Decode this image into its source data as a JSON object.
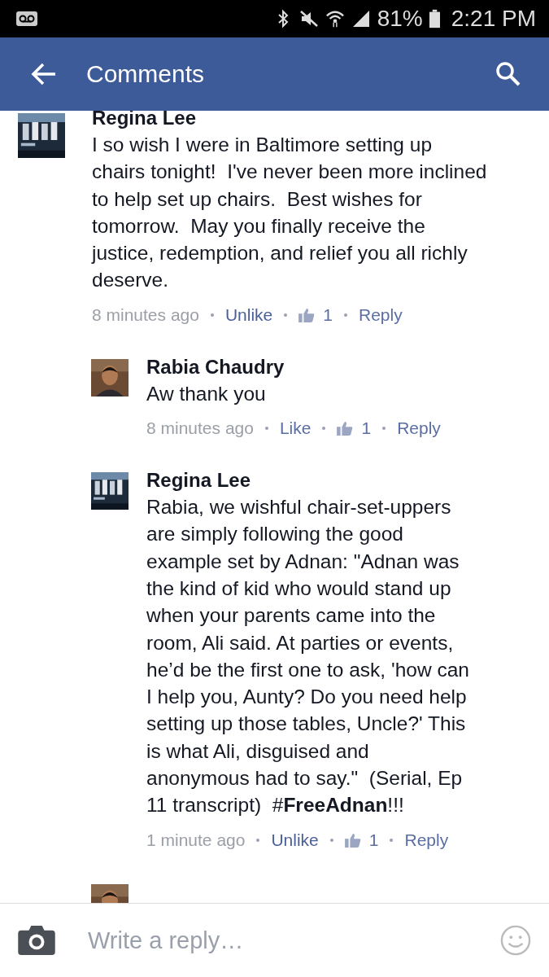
{
  "status_bar": {
    "battery": "81%",
    "time": "2:21 PM"
  },
  "app_bar": {
    "title": "Comments"
  },
  "comments": [
    {
      "kind": "comment",
      "author": "Regina Lee",
      "text": "I so wish I were in Baltimore setting up\nchairs tonight!  I've never been more inclined\nto help set up chairs.  Best wishes for\ntomorrow.  May you finally receive the\njustice, redemption, and relief you all richly\ndeserve.",
      "time": "8 minutes ago",
      "like_action": "Unlike",
      "liked": true,
      "like_count": "1",
      "reply_action": "Reply"
    },
    {
      "kind": "reply",
      "author": "Rabia Chaudry",
      "text": "Aw thank you",
      "time": "8 minutes ago",
      "like_action": "Like",
      "liked": false,
      "like_count": "1",
      "reply_action": "Reply"
    },
    {
      "kind": "reply",
      "author": "Regina Lee",
      "text": "Rabia, we wishful chair-set-uppers\nare simply following the good\nexample set by Adnan: \"Adnan was\nthe kind of kid who would stand up\nwhen your parents came into the\nroom, Ali said. At parties or events,\nhe’d be the first one to ask, 'how can\nI help you, Aunty? Do you need help\nsetting up those tables, Uncle?' This\nis what Ali, disguised and\nanonymous had to say.\"  (Serial, Ep\n11 transcript)  #**FreeAdnan**!!!",
      "time": "1 minute ago",
      "like_action": "Unlike",
      "liked": true,
      "like_count": "1",
      "reply_action": "Reply"
    },
    {
      "kind": "partial"
    }
  ],
  "composer": {
    "placeholder": "Write a reply…"
  }
}
